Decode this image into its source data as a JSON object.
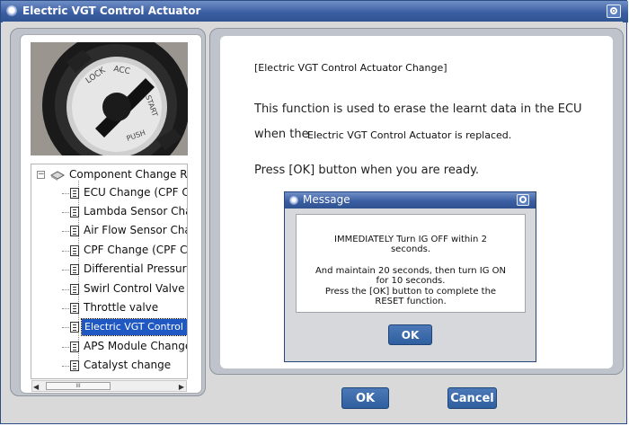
{
  "window": {
    "title": "Electric VGT Control Actuator"
  },
  "tree": {
    "root_label": "Component Change Ro",
    "items": [
      {
        "label": "ECU Change (CPF C"
      },
      {
        "label": "Lambda Sensor Cha"
      },
      {
        "label": "Air Flow Sensor Cha"
      },
      {
        "label": "CPF Change (CPF C"
      },
      {
        "label": "Differential Pressure"
      },
      {
        "label": "Swirl Control Valve C"
      },
      {
        "label": "Throttle valve"
      },
      {
        "label": "Electric VGT Control"
      },
      {
        "label": "APS Module Change"
      },
      {
        "label": "Catalyst change"
      }
    ],
    "selected_index": 7,
    "scroll_thumb_glyph": "III"
  },
  "photo": {
    "labels": [
      "LOCK",
      "ACC",
      "START",
      "PUSH"
    ]
  },
  "content": {
    "title": "[Electric VGT Control Actuator Change]",
    "line1": "This function is used to erase the learnt data in the ECU",
    "line2_prefix": "when the",
    "line2_suffix": "Electric VGT Control Actuator is replaced.",
    "line3": "Press [OK] button when you are ready."
  },
  "buttons": {
    "ok": "OK",
    "cancel": "Cancel"
  },
  "message": {
    "title": "Message",
    "line1": "IMMEDIATELY Turn IG OFF within 2",
    "line2": "seconds.",
    "line3": "And maintain 20 seconds, then turn IG ON",
    "line4": "for 10 seconds.",
    "line5": "Press the [OK] button to complete the",
    "line6": "RESET function.",
    "ok": "OK"
  },
  "colors": {
    "titlebar": "#3b5ea3",
    "button": "#2f5f9f",
    "selection": "#1f58c2",
    "panel": "#bfc3cc"
  }
}
